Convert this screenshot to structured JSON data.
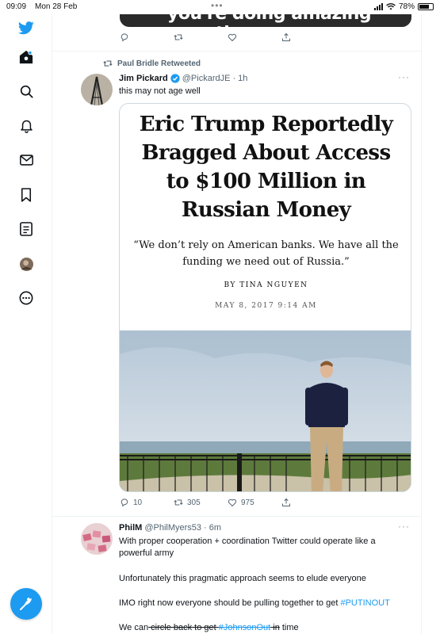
{
  "status_bar": {
    "time": "09:09",
    "date": "Mon 28 Feb",
    "battery": "78%",
    "battery_level": 0.78
  },
  "previous_tweet": {
    "card_text": "you're doing amazing sweetie.",
    "actions": {
      "reply": "",
      "retweet": "",
      "like": ""
    }
  },
  "tweet": {
    "social_context": "Paul Bridle Retweeted",
    "author_name": "Jim Pickard",
    "handle": "@PickardJE",
    "time": "· 1h",
    "text": "this may not age well",
    "card": {
      "headline_lines": [
        "Eric Trump Reportedly",
        "Bragged About Access",
        "to $100 Million in",
        "Russian Money"
      ],
      "quote_lines": [
        "“We don’t rely on American banks. We have all the",
        "funding we need out of Russia.”"
      ],
      "byline": "BY TINA NGUYEN",
      "date": "MAY 8, 2017 9:14 AM"
    },
    "actions": {
      "reply": "10",
      "retweet": "305",
      "like": "975"
    }
  },
  "tweet2": {
    "author_name": "PhilM",
    "handle": "@PhilMyers53",
    "time": "· 6m",
    "para1_line1": "With proper cooperation + coordination Twitter could operate like a",
    "para1_line2": "powerful army",
    "para2": "Unfortunately this pragmatic approach seems to elude everyone",
    "para3_prefix": "IMO right now everyone should be pulling together to get ",
    "para3_hashtag": "#PUTINOUT",
    "para4_a": "We can",
    "para4_b": " circle back to get ",
    "para4_hashtag": "#JohnsonOut",
    "para4_c": " in",
    "para4_d": " time"
  },
  "colors": {
    "accent": "#1d9bf0",
    "verified": "#1d9bf0"
  },
  "icons": [
    "twitter-logo-icon",
    "home-icon",
    "search-icon",
    "bell-icon",
    "mail-icon",
    "bookmark-icon",
    "list-icon",
    "profile-avatar",
    "more-circle-icon",
    "compose-tweet-icon",
    "reply-icon",
    "retweet-icon",
    "like-icon",
    "share-icon",
    "verified-icon",
    "ellipsis-icon"
  ]
}
